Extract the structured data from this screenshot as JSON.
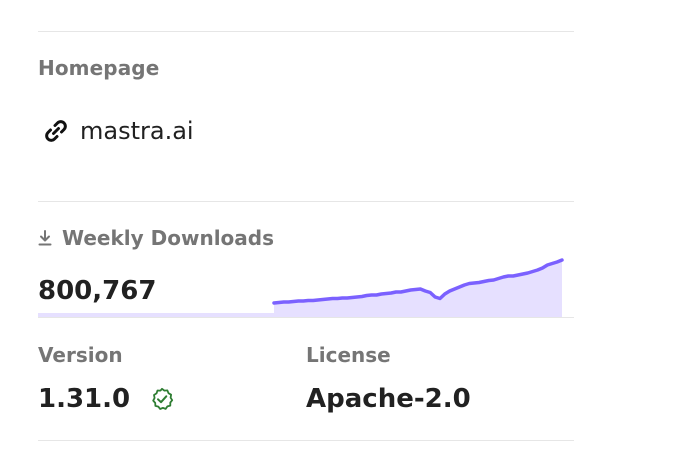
{
  "homepage": {
    "label": "Homepage",
    "link_text": "mastra.ai",
    "icon": "link-icon"
  },
  "downloads": {
    "label": "Weekly Downloads",
    "count": "800,767",
    "icon": "download-icon",
    "sparkline_color": "#7b61ff",
    "sparkline_fill": "#e6e0ff"
  },
  "version": {
    "label": "Version",
    "value": "1.31.0",
    "verified_icon": "verified-check-icon",
    "verified_color": "#2e7d32"
  },
  "license": {
    "label": "License",
    "value": "Apache-2.0"
  }
}
